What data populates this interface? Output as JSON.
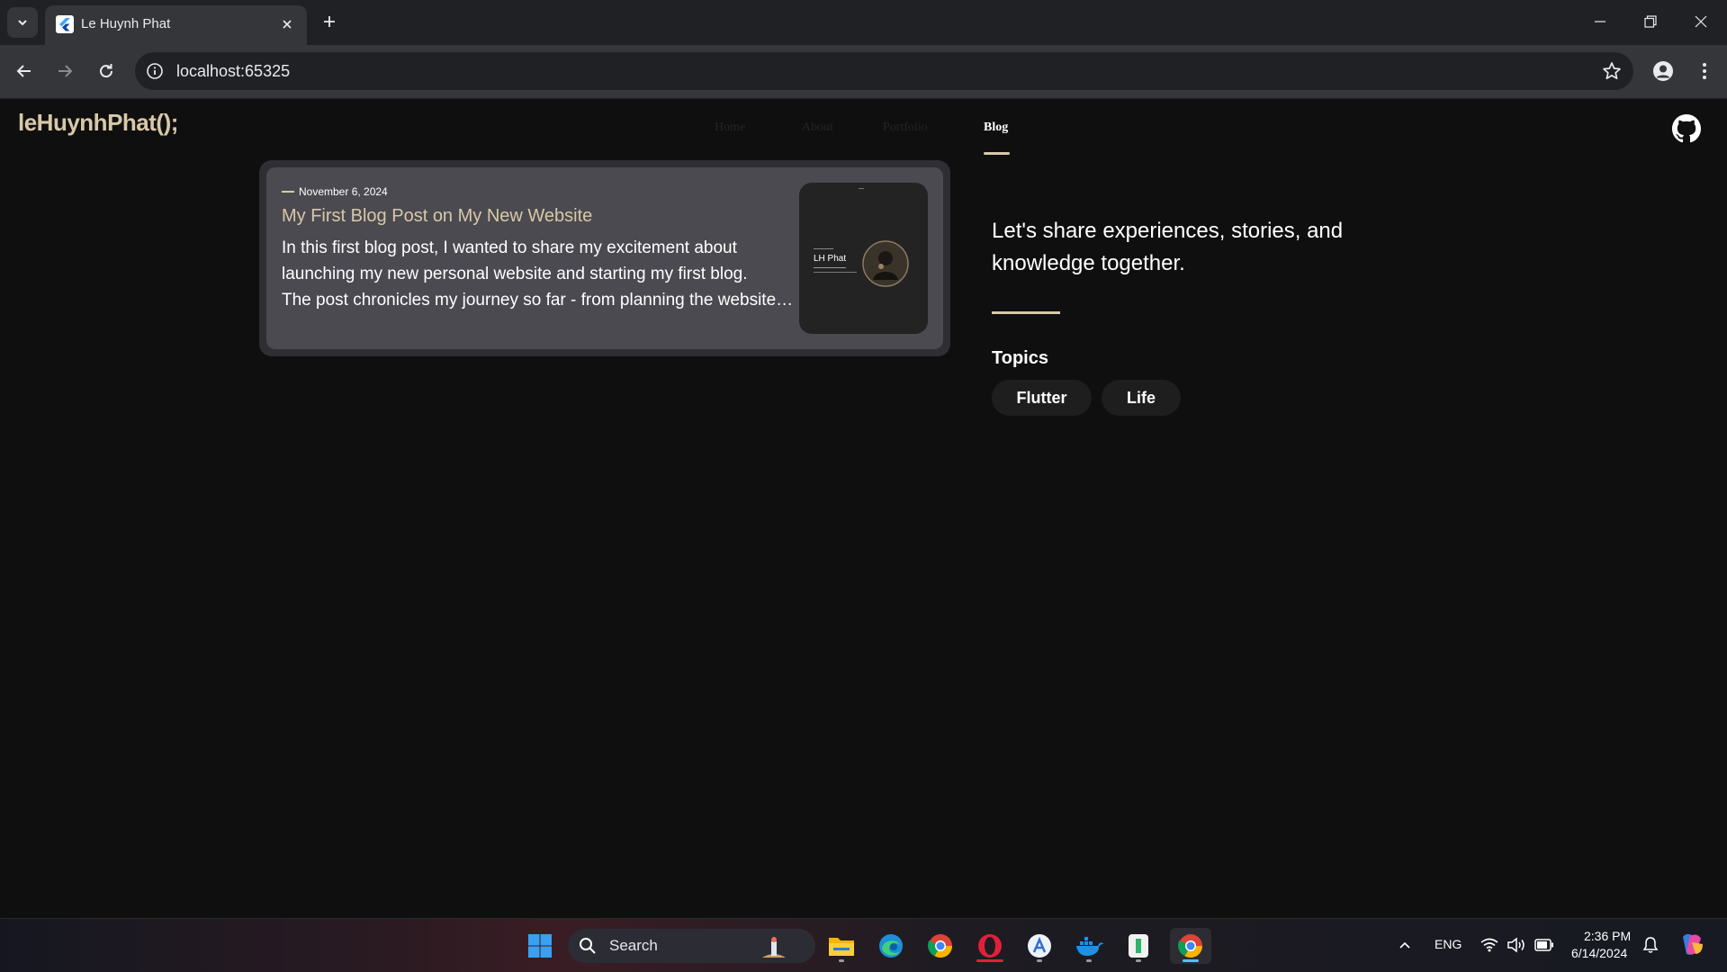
{
  "browser": {
    "tab_title": "Le Huynh Phat",
    "url": "localhost:65325"
  },
  "site": {
    "logo": "leHuynhPhat();",
    "nav": [
      "Home",
      "About",
      "Portfolio",
      "Blog"
    ],
    "active_nav": "Blog"
  },
  "post": {
    "date": "November 6, 2024",
    "title": "My First Blog Post on My New Website",
    "excerpt_lines": [
      "In this first blog post, I wanted to share my excitement about",
      "launching my new personal website and starting my first blog.",
      "The post chronicles my journey so far - from planning the website and designing the layout"
    ],
    "thumbnail": {
      "name": "LH Phat"
    }
  },
  "sidebar": {
    "tagline": "Let's share experiences, stories, and knowledge together.",
    "topics_heading": "Topics",
    "topics": [
      "Flutter",
      "Life"
    ]
  },
  "taskbar": {
    "search_label": "Search",
    "language": "ENG",
    "time": "2:36 PM",
    "date": "6/14/2024"
  },
  "colors": {
    "accent": "#d8c8a8",
    "page_bg": "#0f0f0f",
    "card_bg": "#4b4a50"
  }
}
